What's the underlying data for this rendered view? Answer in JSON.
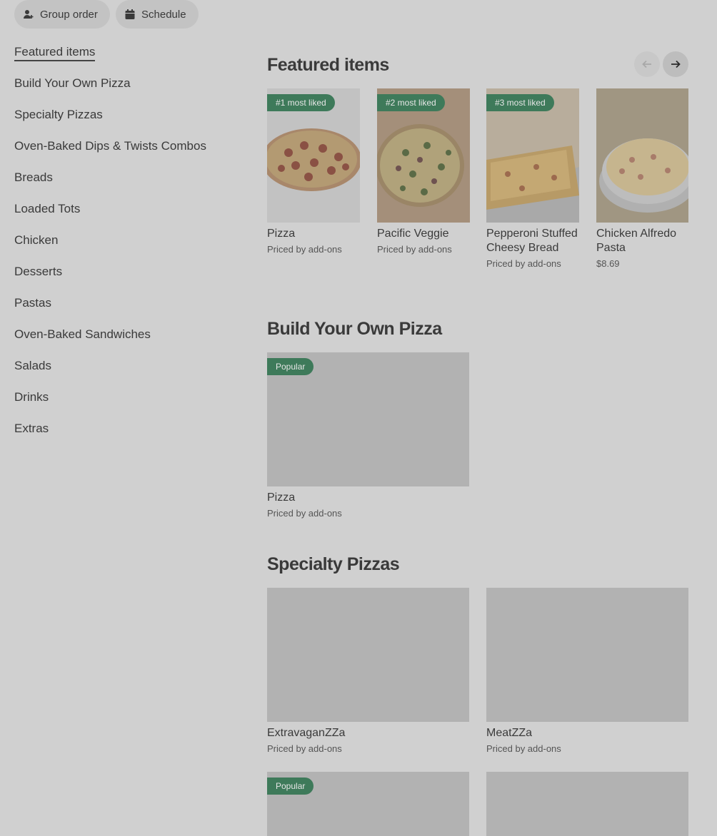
{
  "top_buttons": {
    "group_order": "Group order",
    "schedule": "Schedule"
  },
  "nav": {
    "items": [
      {
        "label": "Featured items",
        "active": true
      },
      {
        "label": "Build Your Own Pizza"
      },
      {
        "label": "Specialty Pizzas"
      },
      {
        "label": "Oven-Baked Dips & Twists Combos"
      },
      {
        "label": "Breads"
      },
      {
        "label": "Loaded Tots"
      },
      {
        "label": "Chicken"
      },
      {
        "label": "Desserts"
      },
      {
        "label": "Pastas"
      },
      {
        "label": "Oven-Baked Sandwiches"
      },
      {
        "label": "Salads"
      },
      {
        "label": "Drinks"
      },
      {
        "label": "Extras"
      }
    ]
  },
  "featured": {
    "title": "Featured items",
    "items": [
      {
        "badge": "#1 most liked",
        "name": "Pizza",
        "price": "Priced by add-ons",
        "image": "pepperoni-pizza"
      },
      {
        "badge": "#2 most liked",
        "name": "Pacific Veggie",
        "price": "Priced by add-ons",
        "image": "veggie-pizza"
      },
      {
        "badge": "#3 most liked",
        "name": "Pepperoni Stuffed Cheesy Bread",
        "price": "Priced by add-ons",
        "image": "cheesy-bread"
      },
      {
        "badge": "",
        "name": "Chicken Alfredo Pasta",
        "price": "$8.69",
        "image": "alfredo-pasta"
      }
    ]
  },
  "build_your_own": {
    "title": "Build Your Own Pizza",
    "items": [
      {
        "badge": "Popular",
        "name": "Pizza",
        "price": "Priced by add-ons"
      }
    ]
  },
  "specialty": {
    "title": "Specialty Pizzas",
    "items": [
      {
        "badge": "",
        "name": "ExtravaganZZa",
        "price": "Priced by add-ons"
      },
      {
        "badge": "",
        "name": "MeatZZa",
        "price": "Priced by add-ons"
      },
      {
        "badge": "Popular",
        "name": "",
        "price": ""
      },
      {
        "badge": "",
        "name": "",
        "price": ""
      }
    ]
  },
  "icons": {
    "group_order": "person-add-icon",
    "schedule": "calendar-icon",
    "prev": "arrow-left-icon",
    "next": "arrow-right-icon"
  },
  "colors": {
    "badge": "#3e7a5a",
    "overlay_bg": "#d0d0d0"
  }
}
